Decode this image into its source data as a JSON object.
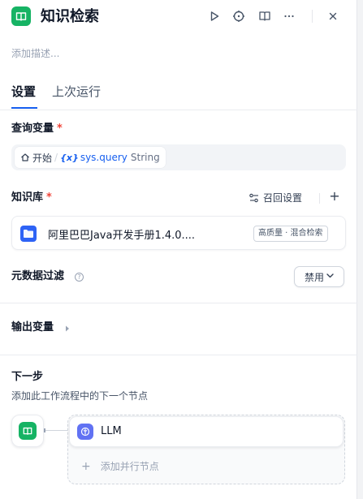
{
  "header": {
    "title": "知识检索",
    "icons": [
      "play-icon",
      "debug-icon",
      "book-open-icon",
      "more-icon",
      "close-icon"
    ],
    "accent_color": "#16b364"
  },
  "description_placeholder": "添加描述...",
  "tabs": [
    {
      "label": "设置",
      "active": true
    },
    {
      "label": "上次运行",
      "active": false
    }
  ],
  "query_variable": {
    "title": "查询变量",
    "required_mark": "*",
    "source": "开始",
    "separator": "/",
    "var_prefix": "{x}",
    "var_name": "sys.query",
    "var_type": "String"
  },
  "knowledge": {
    "title": "知识库",
    "required_mark": "*",
    "recall_settings_label": "召回设置",
    "add_label": "+",
    "items": [
      {
        "name": "阿里巴巴Java开发手册1.4.0....",
        "tag": "高质量 · 混合检索"
      }
    ]
  },
  "metadata_filter": {
    "title": "元数据过滤",
    "help": "?",
    "select_value": "禁用",
    "chevron": "⌄"
  },
  "output_variables": {
    "title": "输出变量"
  },
  "next_step": {
    "title": "下一步",
    "description": "添加此工作流程中的下一个节点",
    "next_node_label": "LLM",
    "add_parallel_plus": "+",
    "add_parallel_label": "添加并行节点"
  },
  "colors": {
    "primary": "#155eef",
    "required": "#f04438",
    "llm_icon": "#6172f3",
    "folder_icon": "#2e63f5"
  }
}
